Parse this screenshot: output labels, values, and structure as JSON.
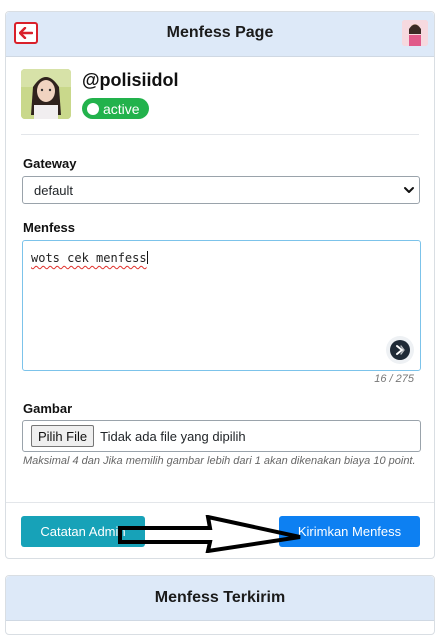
{
  "header": {
    "title": "Menfess Page",
    "back_icon": "arrow-left-icon",
    "accent": "#d9202a"
  },
  "profile": {
    "username": "@polisiidol",
    "status": "active",
    "status_color": "#22b24c"
  },
  "form": {
    "gateway_label": "Gateway",
    "gateway_value": "default",
    "menfess_label": "Menfess",
    "menfess_value": "wots cek menfess",
    "char_count": "16 / 275",
    "gambar_label": "Gambar",
    "file_button_label": "Pilih File",
    "file_status": "Tidak ada file yang dipilih",
    "file_hint": "Maksimal 4 dan Jika memilih gambar lebih dari 1 akan dikenakan biaya 10 point."
  },
  "actions": {
    "catatan_label": "Catatan Admin",
    "kirim_label": "Kirimkan Menfess",
    "catatan_color": "#17a2b8",
    "kirim_color": "#0d80f2"
  },
  "sent_section": {
    "title": "Menfess Terkirim"
  }
}
